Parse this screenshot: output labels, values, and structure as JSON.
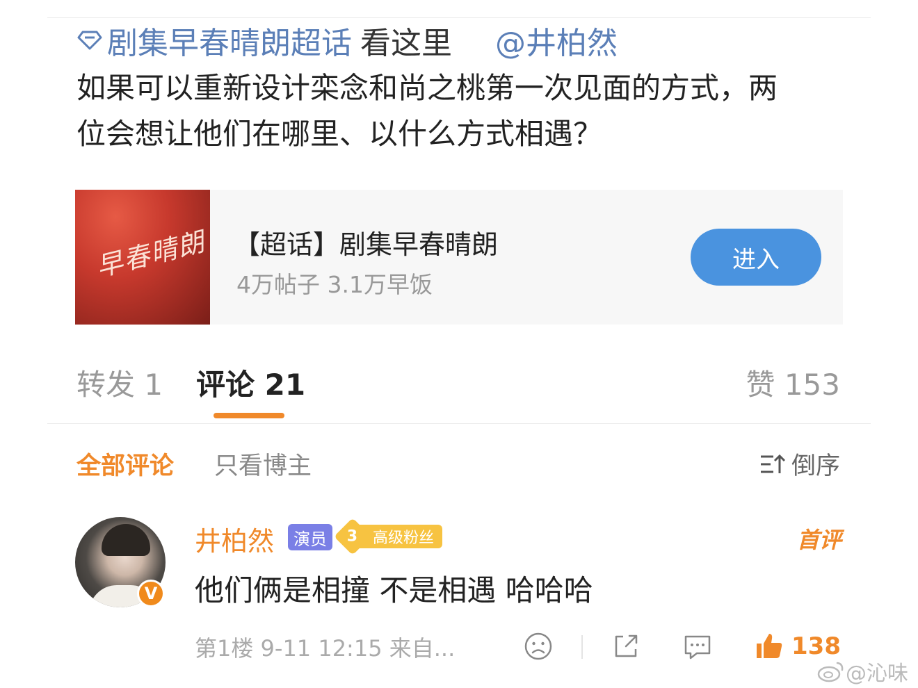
{
  "post": {
    "topic_link": "剧集早春晴朗超话",
    "look_here": "看这里",
    "mention": "@井柏然",
    "body": "如果可以重新设计栾念和尚之桃第一次见面的方式，两位会想让他们在哪里、以什么方式相遇？"
  },
  "card": {
    "thumb_text": "早春晴朗",
    "title": "【超话】剧集早春晴朗",
    "stats": "4万帖子 3.1万早饭",
    "enter_label": "进入"
  },
  "tabs": {
    "repost": "转发 1",
    "comment": "评论 21",
    "like": "赞 153"
  },
  "filter": {
    "all": "全部评论",
    "op_only": "只看博主",
    "sort": "倒序"
  },
  "comment": {
    "name": "井柏然",
    "verify_badge": "V",
    "tag_actor": "演员",
    "fan_level": "3",
    "fan_label": "高级粉丝",
    "first_comment": "首评",
    "text": "他们俩是相撞 不是相遇 哈哈哈",
    "meta": "第1楼 9-11 12:15 来自...",
    "like_count": "138"
  },
  "watermark": "@沁味",
  "colors": {
    "link_blue": "#5b7fb7",
    "accent_orange": "#f0892a",
    "button_blue": "#4a93df"
  }
}
